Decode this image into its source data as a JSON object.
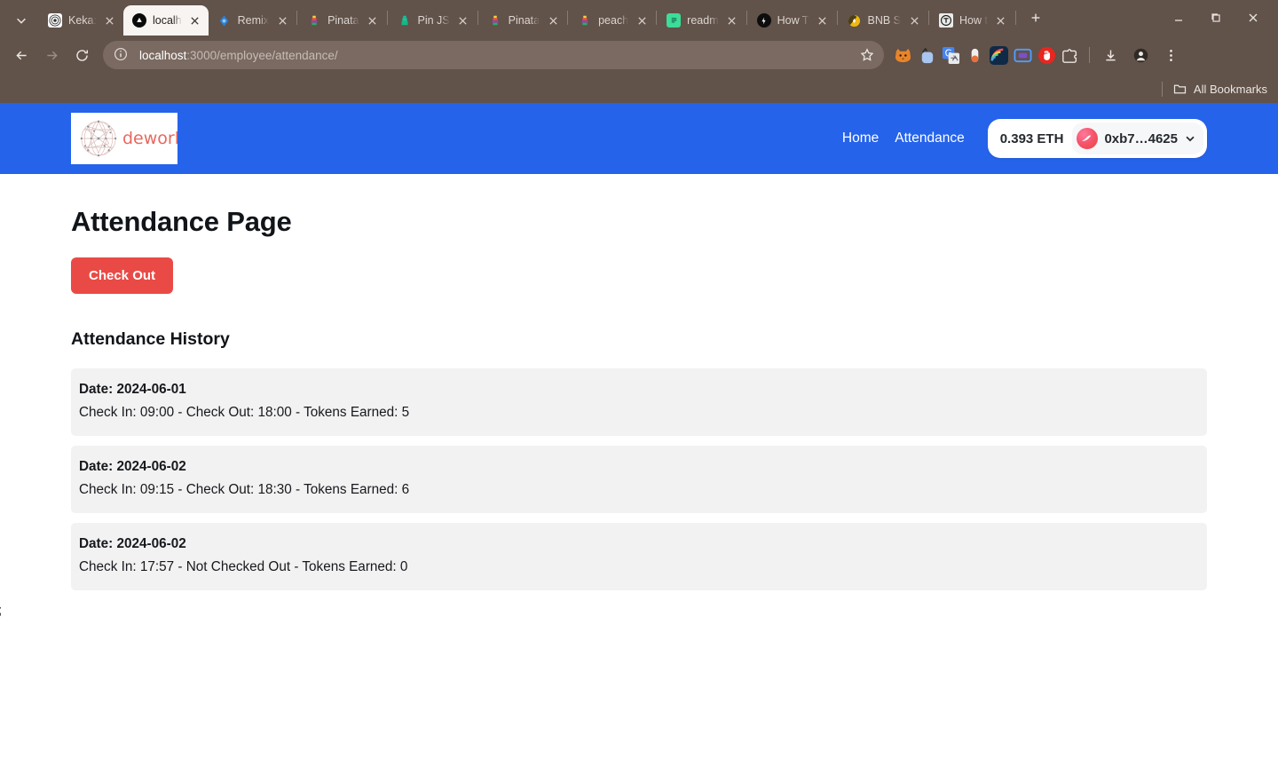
{
  "browser": {
    "tabs": [
      {
        "title": "Keka:",
        "icon": "keka-icon",
        "active": false
      },
      {
        "title": "localh",
        "icon": "nextjs-icon",
        "active": true
      },
      {
        "title": "Remix",
        "icon": "remix-icon",
        "active": false
      },
      {
        "title": "Pinata",
        "icon": "pinata-icon",
        "active": false
      },
      {
        "title": "Pin JS",
        "icon": "pinjs-icon",
        "active": false
      },
      {
        "title": "Pinata",
        "icon": "pinata-icon",
        "active": false
      },
      {
        "title": "peach",
        "icon": "pinata-icon",
        "active": false
      },
      {
        "title": "readm",
        "icon": "readme-icon",
        "active": false
      },
      {
        "title": "How T",
        "icon": "howto-icon",
        "active": false
      },
      {
        "title": "BNB S",
        "icon": "bnb-icon",
        "active": false
      },
      {
        "title": "How t",
        "icon": "medium-icon",
        "active": false
      }
    ],
    "url_host": "localhost",
    "url_rest": ":3000/employee/attendance/",
    "bookmarks_label": "All Bookmarks",
    "extensions": [
      "fox-extension-icon",
      "metamask-extension-icon",
      "google-translate-icon",
      "capsule-extension-icon",
      "rainbow-wallet-icon",
      "screen-recorder-icon",
      "stop-extension-icon",
      "puzzle-extensions-icon"
    ]
  },
  "site": {
    "logo_word": "dework",
    "nav_links": [
      "Home",
      "Attendance"
    ],
    "wallet": {
      "balance": "0.393 ETH",
      "address": "0xb7…4625"
    }
  },
  "main": {
    "page_title": "Attendance Page",
    "checkout_label": "Check Out",
    "history_title": "Attendance History",
    "history": [
      {
        "date": "Date: 2024-06-01",
        "detail": "Check In: 09:00 - Check Out: 18:00 - Tokens Earned: 5"
      },
      {
        "date": "Date: 2024-06-02",
        "detail": "Check In: 09:15 - Check Out: 18:30 - Tokens Earned: 6"
      },
      {
        "date": "Date: 2024-06-02",
        "detail": "Check In: 17:57 - Not Checked Out - Tokens Earned: 0"
      }
    ],
    "stray_text": ";"
  },
  "colors": {
    "navbar_blue": "#2563EB",
    "button_red": "#EA4A45",
    "row_gray": "#F2F2F3",
    "chrome_brown": "#61524A"
  }
}
